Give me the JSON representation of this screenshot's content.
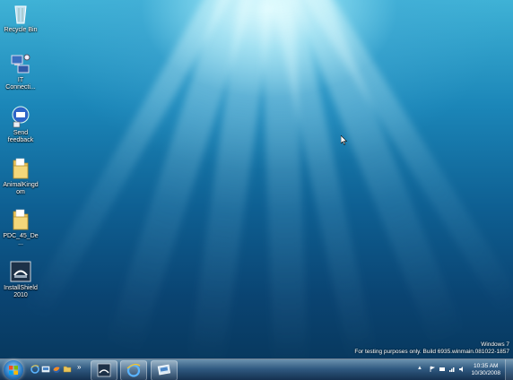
{
  "desktop_icons": [
    {
      "label": "Recycle Bin",
      "icon": "recycle-bin-icon"
    },
    {
      "label": "IT Connecti...",
      "icon": "network-connection-icon"
    },
    {
      "label": "Send feedback",
      "icon": "send-feedback-icon"
    },
    {
      "label": "AnimalKingd om",
      "icon": "folder-icon"
    },
    {
      "label": "PDC_45_De...",
      "icon": "folder-icon"
    },
    {
      "label": "InstallShield 2010",
      "icon": "installshield-icon"
    }
  ],
  "watermark": {
    "line1": "Windows 7",
    "line2": "For testing purposes only. Build 6935.winmain.081022-1857"
  },
  "taskbar": {
    "quick_launch": [
      "internet-explorer-icon",
      "show-desktop-icon",
      "firefox-icon",
      "folder-icon"
    ],
    "overflow": "»",
    "buttons": [
      "installshield-task-icon",
      "internet-explorer-task-icon",
      "windows-explorer-task-icon"
    ],
    "tray_arrow": "▲",
    "clock_time": "10:35 AM",
    "clock_date": "10/30/2008"
  },
  "colors": {
    "accent": "#1b86b8",
    "taskbar": "#2d5073"
  }
}
